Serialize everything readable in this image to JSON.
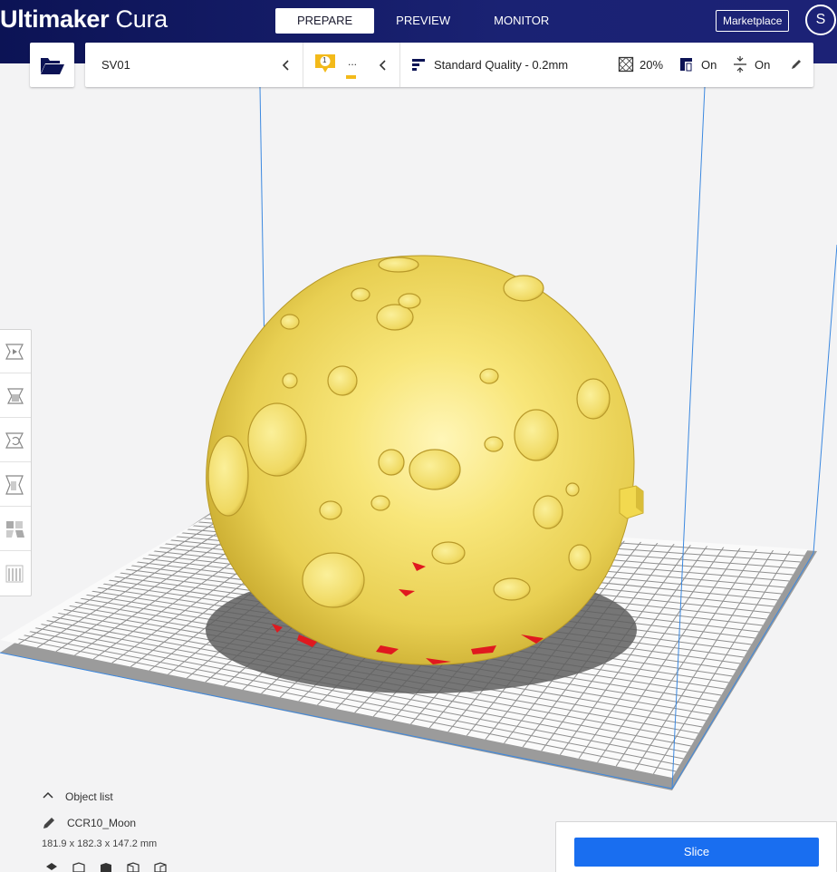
{
  "header": {
    "logo_bold": "Ultimaker",
    "logo_light": " Cura",
    "tabs": [
      {
        "label": "PREPARE",
        "active": true
      },
      {
        "label": "PREVIEW",
        "active": false
      },
      {
        "label": "MONITOR",
        "active": false
      }
    ],
    "marketplace_label": "Marketplace",
    "account_initial": "S"
  },
  "toolbar": {
    "open_icon": "folder-open-icon",
    "printer_name": "SV01",
    "extruder_number": "1",
    "extruder_material": "...",
    "extruder_color": "#f3ba1a",
    "quality_label": "Standard Quality - 0.2mm",
    "infill": "20%",
    "support": "On",
    "adhesion": "On"
  },
  "tools": [
    "move-tool-icon",
    "scale-tool-icon",
    "rotate-tool-icon",
    "mirror-tool-icon",
    "per-model-settings-icon",
    "support-blocker-icon"
  ],
  "object_list": {
    "toggle_label": "Object list",
    "object_name": "CCR10_Moon",
    "dimensions": "181.9 x 182.3 x 147.2 mm"
  },
  "slice": {
    "label": "Slice"
  },
  "colors": {
    "header_bg": "#0c1355",
    "accent_blue": "#196ef0",
    "model_yellow": "#f5e05e",
    "overhang_red": "#e0191f",
    "volume_line": "#3b88e0"
  }
}
